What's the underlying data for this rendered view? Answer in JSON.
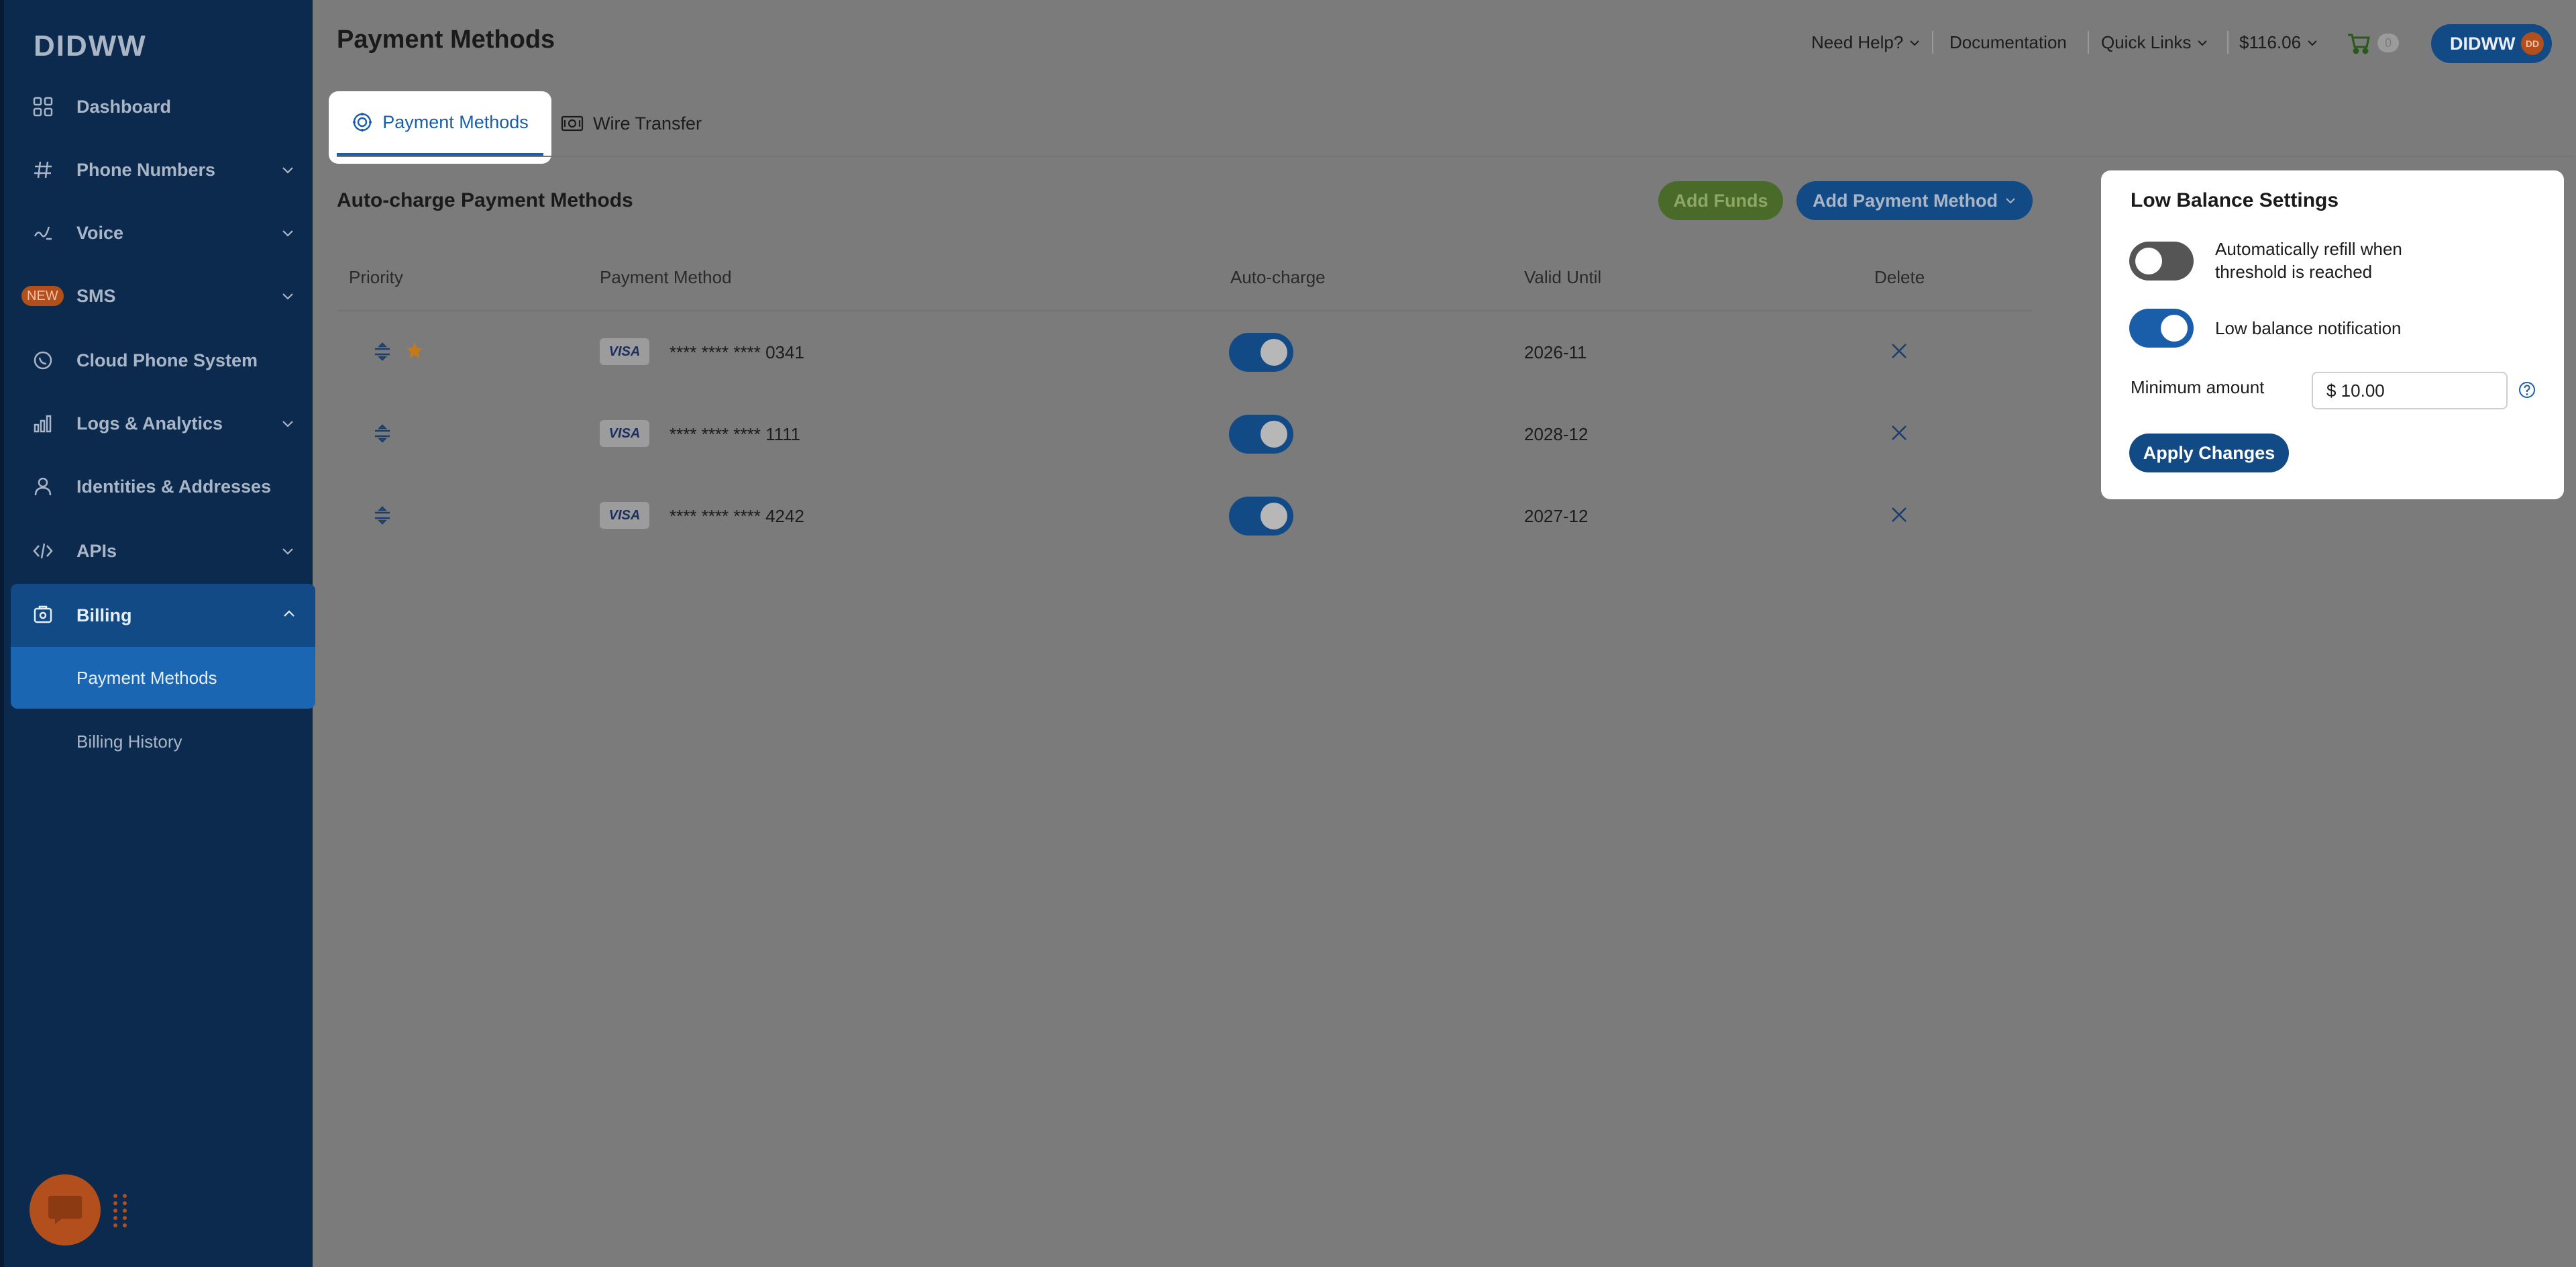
{
  "brand": {
    "logo": "DIDWW"
  },
  "sidebar": {
    "items": [
      {
        "label": "Dashboard",
        "icon": "grid-icon"
      },
      {
        "label": "Phone Numbers",
        "icon": "hash-icon"
      },
      {
        "label": "Voice",
        "icon": "phone-wave-icon"
      },
      {
        "label": "SMS",
        "icon": "sms-icon",
        "badge": "NEW"
      },
      {
        "label": "Cloud Phone System",
        "icon": "cloud-icon"
      },
      {
        "label": "Logs & Analytics",
        "icon": "bar-chart-icon"
      },
      {
        "label": "Identities & Addresses",
        "icon": "person-icon"
      },
      {
        "label": "APIs",
        "icon": "code-icon"
      },
      {
        "label": "Billing",
        "icon": "billing-icon"
      }
    ],
    "billing_sub": [
      "Payment Methods",
      "Billing History"
    ]
  },
  "header": {
    "title": "Payment Methods",
    "need_help": "Need Help?",
    "documentation": "Documentation",
    "quick_links": "Quick Links",
    "balance": "$116.06",
    "cart_count": "0",
    "user": "DIDWW",
    "user_initials": "DD"
  },
  "tabs": [
    "Payment Methods",
    "Wire Transfer"
  ],
  "section": {
    "title": "Auto-charge Payment Methods",
    "add_funds": "Add Funds",
    "add_payment_method": "Add Payment Method"
  },
  "table": {
    "headers": [
      "Priority",
      "Payment Method",
      "Auto-charge",
      "Valid Until",
      "Delete"
    ],
    "rows": [
      {
        "brand": "VISA",
        "number": "**** **** **** 0341",
        "autocharge": true,
        "valid": "2026-11",
        "primary": true
      },
      {
        "brand": "VISA",
        "number": "**** **** **** 1111",
        "autocharge": true,
        "valid": "2028-12",
        "primary": false
      },
      {
        "brand": "VISA",
        "number": "**** **** **** 4242",
        "autocharge": true,
        "valid": "2027-12",
        "primary": false
      }
    ]
  },
  "low_balance": {
    "title": "Low Balance Settings",
    "auto_refill_label": "Automatically refill when threshold is reached",
    "auto_refill": false,
    "notification_label": "Low balance notification",
    "notification": true,
    "minimum_label": "Minimum amount",
    "minimum_value": "$ 10.00",
    "apply": "Apply Changes"
  },
  "colors": {
    "sidebar": "#0b2a4d",
    "accent": "#124a86",
    "orange": "#b24f1c",
    "green": "#4a6a2a"
  }
}
